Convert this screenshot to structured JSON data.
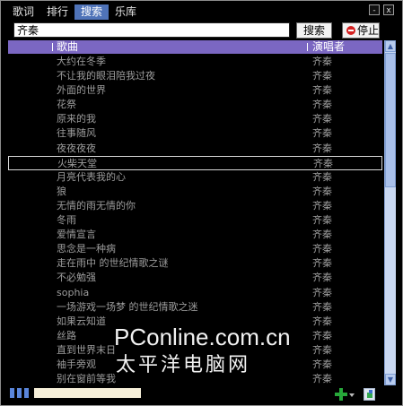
{
  "tabs": [
    {
      "label": "歌词",
      "active": false
    },
    {
      "label": "排行",
      "active": false
    },
    {
      "label": "搜索",
      "active": true
    },
    {
      "label": "乐库",
      "active": false
    }
  ],
  "window_controls": {
    "minimize": "-",
    "close": "x"
  },
  "search": {
    "value": "齐秦",
    "search_button": "搜索",
    "stop_button": "停止"
  },
  "table": {
    "columns": [
      "歌曲",
      "演唱者"
    ],
    "selected_index": 7,
    "rows": [
      {
        "song": "大约在冬季",
        "artist": "齐秦"
      },
      {
        "song": "不让我的眼泪陪我过夜",
        "artist": "齐秦"
      },
      {
        "song": "外面的世界",
        "artist": "齐秦"
      },
      {
        "song": "花祭",
        "artist": "齐秦"
      },
      {
        "song": "原来的我",
        "artist": "齐秦"
      },
      {
        "song": "往事随风",
        "artist": "齐秦"
      },
      {
        "song": "夜夜夜夜",
        "artist": "齐秦"
      },
      {
        "song": "火柴天堂",
        "artist": "齐秦"
      },
      {
        "song": "月亮代表我的心",
        "artist": "齐秦"
      },
      {
        "song": "狼",
        "artist": "齐秦"
      },
      {
        "song": "无情的雨无情的你",
        "artist": "齐秦"
      },
      {
        "song": "冬雨",
        "artist": "齐秦"
      },
      {
        "song": "爱情宣言",
        "artist": "齐秦"
      },
      {
        "song": "思念是一种病",
        "artist": "齐秦"
      },
      {
        "song": "走在雨中 的世纪情歌之谜",
        "artist": "齐秦"
      },
      {
        "song": "不必勉强",
        "artist": "齐秦"
      },
      {
        "song": "sophia",
        "artist": "齐秦"
      },
      {
        "song": "一场游戏一场梦 的世纪情歌之迷",
        "artist": "齐秦"
      },
      {
        "song": "如果云知道",
        "artist": "齐秦"
      },
      {
        "song": "丝路",
        "artist": "齐秦"
      },
      {
        "song": "直到世界末日",
        "artist": "齐秦"
      },
      {
        "song": "袖手旁观",
        "artist": "齐秦"
      },
      {
        "song": "别在窗前等我",
        "artist": "齐秦"
      }
    ]
  },
  "watermark": {
    "line1": "PConline.com.cn",
    "line2": "太平洋电脑网"
  },
  "colors": {
    "header_bg": "#7b67c2",
    "active_tab": "#4f73b8",
    "scrollbar": "#c9d8f2"
  },
  "icons": {
    "add": "plus-icon",
    "image": "image-icon"
  }
}
